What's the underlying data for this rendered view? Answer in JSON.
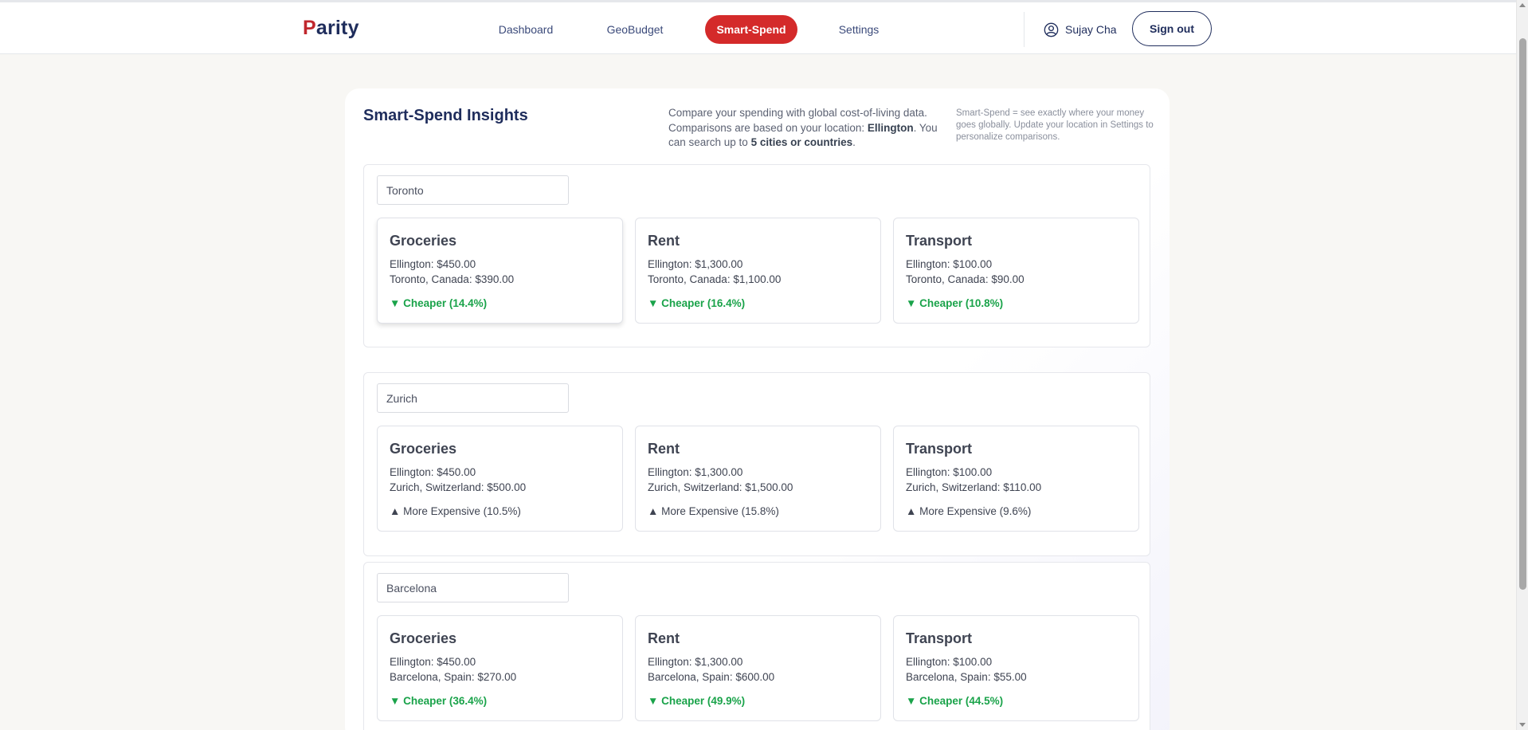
{
  "brand": {
    "logo_first": "P",
    "logo_rest": "arity"
  },
  "nav": {
    "items": [
      {
        "label": "Dashboard",
        "active": false
      },
      {
        "label": "GeoBudget",
        "active": false
      },
      {
        "label": "Smart-Spend",
        "active": true
      },
      {
        "label": "Settings",
        "active": false
      }
    ]
  },
  "user": {
    "name": "Sujay Cha",
    "icon": "user-circle-icon",
    "signout_label": "Sign out"
  },
  "colors": {
    "brand_red": "#d42a2a",
    "navy": "#1f2d5c",
    "cheaper_green": "#1aa34a"
  },
  "panel": {
    "title": "Smart-Spend Insights",
    "desc_part1": "Compare your spending with global cost-of-living data. Comparisons are based on your location: ",
    "desc_location": "Ellington",
    "desc_part2": ". You can search up to ",
    "desc_limit": "5 cities or countries",
    "desc_part3": ".",
    "note": "Smart-Spend = see exactly where your money goes globally. Update your location in Settings to personalize comparisons."
  },
  "cities": [
    {
      "query": "Toronto",
      "cards": [
        {
          "title": "Groceries",
          "home": "Ellington: $450.00",
          "other": "Toronto, Canada: $390.00",
          "status": "▼ Cheaper (14.4%)",
          "kind": "cheaper"
        },
        {
          "title": "Rent",
          "home": "Ellington: $1,300.00",
          "other": "Toronto, Canada: $1,100.00",
          "status": "▼ Cheaper (16.4%)",
          "kind": "cheaper"
        },
        {
          "title": "Transport",
          "home": "Ellington: $100.00",
          "other": "Toronto, Canada: $90.00",
          "status": "▼ Cheaper (10.8%)",
          "kind": "cheaper"
        }
      ]
    },
    {
      "query": "Zurich",
      "cards": [
        {
          "title": "Groceries",
          "home": "Ellington: $450.00",
          "other": "Zurich, Switzerland: $500.00",
          "status": "▲ More Expensive (10.5%)",
          "kind": "expensive"
        },
        {
          "title": "Rent",
          "home": "Ellington: $1,300.00",
          "other": "Zurich, Switzerland: $1,500.00",
          "status": "▲ More Expensive (15.8%)",
          "kind": "expensive"
        },
        {
          "title": "Transport",
          "home": "Ellington: $100.00",
          "other": "Zurich, Switzerland: $110.00",
          "status": "▲ More Expensive (9.6%)",
          "kind": "expensive"
        }
      ]
    },
    {
      "query": "Barcelona",
      "cards": [
        {
          "title": "Groceries",
          "home": "Ellington: $450.00",
          "other": "Barcelona, Spain: $270.00",
          "status": "▼ Cheaper (36.4%)",
          "kind": "cheaper"
        },
        {
          "title": "Rent",
          "home": "Ellington: $1,300.00",
          "other": "Barcelona, Spain: $600.00",
          "status": "▼ Cheaper (49.9%)",
          "kind": "cheaper"
        },
        {
          "title": "Transport",
          "home": "Ellington: $100.00",
          "other": "Barcelona, Spain: $55.00",
          "status": "▼ Cheaper (44.5%)",
          "kind": "cheaper"
        }
      ]
    }
  ]
}
